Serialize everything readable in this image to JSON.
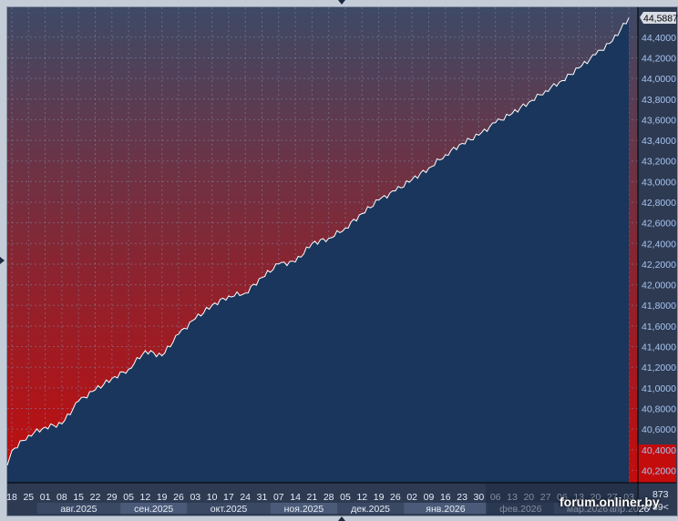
{
  "chart_data": {
    "type": "area",
    "x": [
      "18",
      "25",
      "01",
      "08",
      "15",
      "22",
      "29",
      "05",
      "12",
      "19",
      "26",
      "03",
      "10",
      "17",
      "24",
      "31",
      "07",
      "14",
      "21",
      "28",
      "05",
      "12",
      "19",
      "26",
      "02",
      "09",
      "16",
      "23",
      "30",
      "06",
      "13",
      "20",
      "27",
      "06",
      "13",
      "20",
      "27",
      "03"
    ],
    "values": [
      40.39,
      40.54,
      40.62,
      40.65,
      40.87,
      40.98,
      41.09,
      41.18,
      41.36,
      41.31,
      41.52,
      41.67,
      41.8,
      41.89,
      41.92,
      42.07,
      42.2,
      42.22,
      42.4,
      42.45,
      42.55,
      42.69,
      42.82,
      42.91,
      43.02,
      43.13,
      43.26,
      43.37,
      43.45,
      43.57,
      43.66,
      43.77,
      43.88,
      43.98,
      44.1,
      44.23,
      44.36,
      44.5887
    ],
    "months": [
      "авг.2025",
      "сен.2025",
      "окт.2025",
      "ноя.2025",
      "дек.2025",
      "янв.2026",
      "фев.2026",
      "мар.2026",
      "апр.2026"
    ],
    "yticks": [
      "40,2000",
      "40,4000",
      "40,6000",
      "40,8000",
      "41,0000",
      "41,2000",
      "41,4000",
      "41,6000",
      "41,8000",
      "42,0000",
      "42,2000",
      "42,4000",
      "42,6000",
      "42,8000",
      "43,0000",
      "43,2000",
      "43,4000",
      "43,6000",
      "43,8000",
      "44,0000",
      "44,2000",
      "44,4000"
    ],
    "ylim": [
      40.08,
      44.69
    ],
    "last_value_label": "44,5887",
    "grid": true,
    "colors": {
      "fill": "#1a365c",
      "line": "#ffffff",
      "bg_top": "#3e4a66",
      "bg_bottom": "#c01010"
    }
  },
  "axis_corner": {
    "top": "873",
    "bottom": ">789<"
  },
  "watermark": "forum.onliner.by"
}
